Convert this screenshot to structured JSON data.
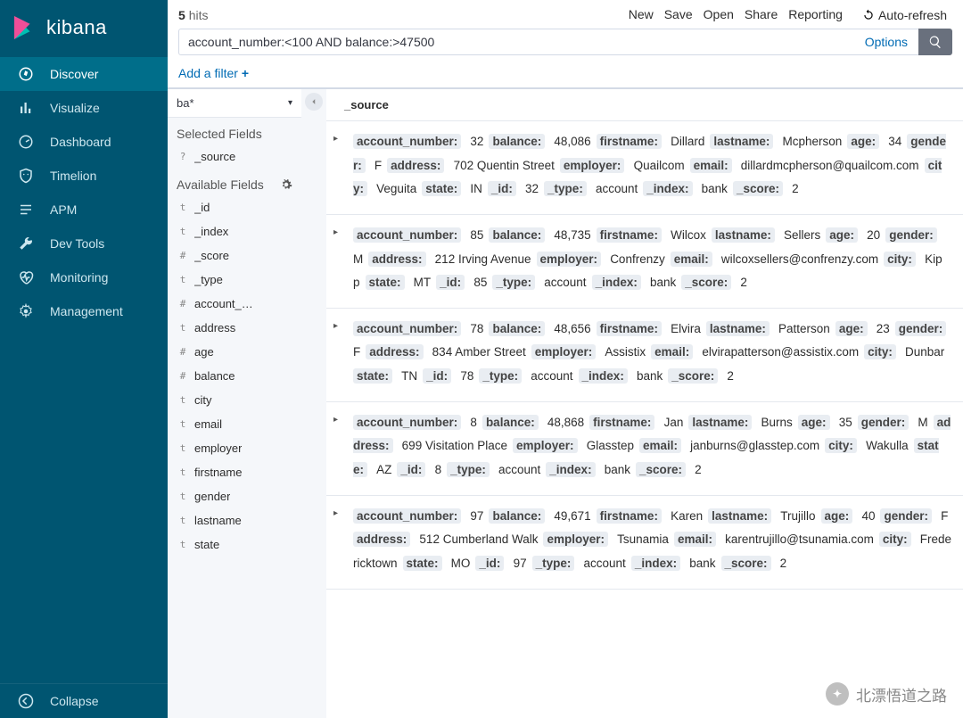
{
  "brand": "kibana",
  "nav": {
    "items": [
      {
        "id": "discover",
        "label": "Discover",
        "icon": "compass-icon",
        "active": true
      },
      {
        "id": "visualize",
        "label": "Visualize",
        "icon": "bar-chart-icon",
        "active": false
      },
      {
        "id": "dashboard",
        "label": "Dashboard",
        "icon": "gauge-icon",
        "active": false
      },
      {
        "id": "timelion",
        "label": "Timelion",
        "icon": "shield-face-icon",
        "active": false
      },
      {
        "id": "apm",
        "label": "APM",
        "icon": "list-icon",
        "active": false
      },
      {
        "id": "devtools",
        "label": "Dev Tools",
        "icon": "wrench-icon",
        "active": false
      },
      {
        "id": "monitoring",
        "label": "Monitoring",
        "icon": "heart-pulse-icon",
        "active": false
      },
      {
        "id": "management",
        "label": "Management",
        "icon": "gear-icon",
        "active": false
      }
    ],
    "collapse_label": "Collapse"
  },
  "top": {
    "hits_count": "5",
    "hits_label": "hits",
    "links": [
      "New",
      "Save",
      "Open",
      "Share",
      "Reporting"
    ],
    "auto_refresh_label": "Auto-refresh"
  },
  "search": {
    "query": "account_number:<100 AND balance:>47500",
    "options_label": "Options"
  },
  "filterbar": {
    "add_label": "Add a filter"
  },
  "index_pattern": "ba*",
  "fields": {
    "selected_header": "Selected Fields",
    "selected": [
      {
        "type": "?",
        "name": "_source"
      }
    ],
    "available_header": "Available Fields",
    "available": [
      {
        "type": "t",
        "name": "_id"
      },
      {
        "type": "t",
        "name": "_index"
      },
      {
        "type": "#",
        "name": "_score"
      },
      {
        "type": "t",
        "name": "_type"
      },
      {
        "type": "#",
        "name": "account_…"
      },
      {
        "type": "t",
        "name": "address"
      },
      {
        "type": "#",
        "name": "age"
      },
      {
        "type": "#",
        "name": "balance"
      },
      {
        "type": "t",
        "name": "city"
      },
      {
        "type": "t",
        "name": "email"
      },
      {
        "type": "t",
        "name": "employer"
      },
      {
        "type": "t",
        "name": "firstname"
      },
      {
        "type": "t",
        "name": "gender"
      },
      {
        "type": "t",
        "name": "lastname"
      },
      {
        "type": "t",
        "name": "state"
      }
    ]
  },
  "docs": {
    "source_header": "_source",
    "hit_keys": [
      "account_number",
      "balance",
      "firstname",
      "lastname",
      "age",
      "gender",
      "address",
      "employer",
      "email",
      "city",
      "state",
      "_id",
      "_type",
      "_index",
      "_score"
    ],
    "hits": [
      {
        "account_number": "32",
        "balance": "48,086",
        "firstname": "Dillard",
        "lastname": "Mcpherson",
        "age": "34",
        "gender": "F",
        "address": "702 Quentin Street",
        "employer": "Quailcom",
        "email": "dillardmcpherson@quailcom.com",
        "city": "Veguita",
        "state": "IN",
        "_id": "32",
        "_type": "account",
        "_index": "bank",
        "_score": "2"
      },
      {
        "account_number": "85",
        "balance": "48,735",
        "firstname": "Wilcox",
        "lastname": "Sellers",
        "age": "20",
        "gender": "M",
        "address": "212 Irving Avenue",
        "employer": "Confrenzy",
        "email": "wilcoxsellers@confrenzy.com",
        "city": "Kipp",
        "state": "MT",
        "_id": "85",
        "_type": "account",
        "_index": "bank",
        "_score": "2"
      },
      {
        "account_number": "78",
        "balance": "48,656",
        "firstname": "Elvira",
        "lastname": "Patterson",
        "age": "23",
        "gender": "F",
        "address": "834 Amber Street",
        "employer": "Assistix",
        "email": "elvirapatterson@assistix.com",
        "city": "Dunbar",
        "state": "TN",
        "_id": "78",
        "_type": "account",
        "_index": "bank",
        "_score": "2"
      },
      {
        "account_number": "8",
        "balance": "48,868",
        "firstname": "Jan",
        "lastname": "Burns",
        "age": "35",
        "gender": "M",
        "address": "699 Visitation Place",
        "employer": "Glasstep",
        "email": "janburns@glasstep.com",
        "city": "Wakulla",
        "state": "AZ",
        "_id": "8",
        "_type": "account",
        "_index": "bank",
        "_score": "2"
      },
      {
        "account_number": "97",
        "balance": "49,671",
        "firstname": "Karen",
        "lastname": "Trujillo",
        "age": "40",
        "gender": "F",
        "address": "512 Cumberland Walk",
        "employer": "Tsunamia",
        "email": "karentrujillo@tsunamia.com",
        "city": "Fredericktown",
        "state": "MO",
        "_id": "97",
        "_type": "account",
        "_index": "bank",
        "_score": "2"
      }
    ]
  },
  "watermark": "北漂悟道之路"
}
